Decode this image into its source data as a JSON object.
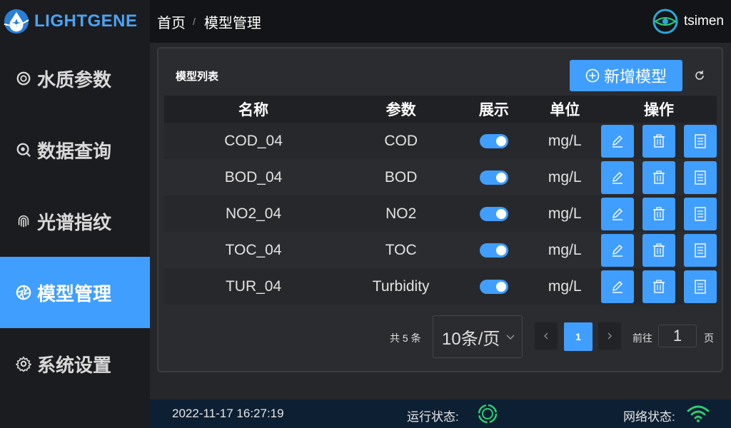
{
  "app": {
    "logo_text": "LIGHTGENE"
  },
  "breadcrumb": {
    "home": "首页",
    "separator": "/",
    "current": "模型管理"
  },
  "user": {
    "name": "tsimen"
  },
  "sidebar": {
    "items": [
      {
        "label": "水质参数",
        "icon": "water-quality-icon"
      },
      {
        "label": "数据查询",
        "icon": "search-icon"
      },
      {
        "label": "光谱指纹",
        "icon": "fingerprint-icon"
      },
      {
        "label": "模型管理",
        "icon": "aperture-icon",
        "active": true
      },
      {
        "label": "系统设置",
        "icon": "gear-icon"
      }
    ]
  },
  "panel": {
    "title": "模型列表",
    "add_button": "新增模型",
    "columns": [
      "名称",
      "参数",
      "展示",
      "单位",
      "操作"
    ],
    "rows": [
      {
        "name": "COD_04",
        "param": "COD",
        "show": true,
        "unit": "mg/L"
      },
      {
        "name": "BOD_04",
        "param": "BOD",
        "show": true,
        "unit": "mg/L"
      },
      {
        "name": "NO2_04",
        "param": "NO2",
        "show": true,
        "unit": "mg/L"
      },
      {
        "name": "TOC_04",
        "param": "TOC",
        "show": true,
        "unit": "mg/L"
      },
      {
        "name": "TUR_04",
        "param": "Turbidity",
        "show": true,
        "unit": "mg/L"
      }
    ]
  },
  "pagination": {
    "total": "共 5 条",
    "page_size": "10条/页",
    "current_page": "1",
    "goto_label": "前往",
    "goto_value": "1",
    "goto_unit": "页"
  },
  "footer": {
    "datetime": "2022-11-17 16:27:19",
    "run_status_label": "运行状态:",
    "network_status_label": "网络状态:"
  },
  "colors": {
    "accent": "#409eff",
    "ok": "#2ecc71"
  }
}
